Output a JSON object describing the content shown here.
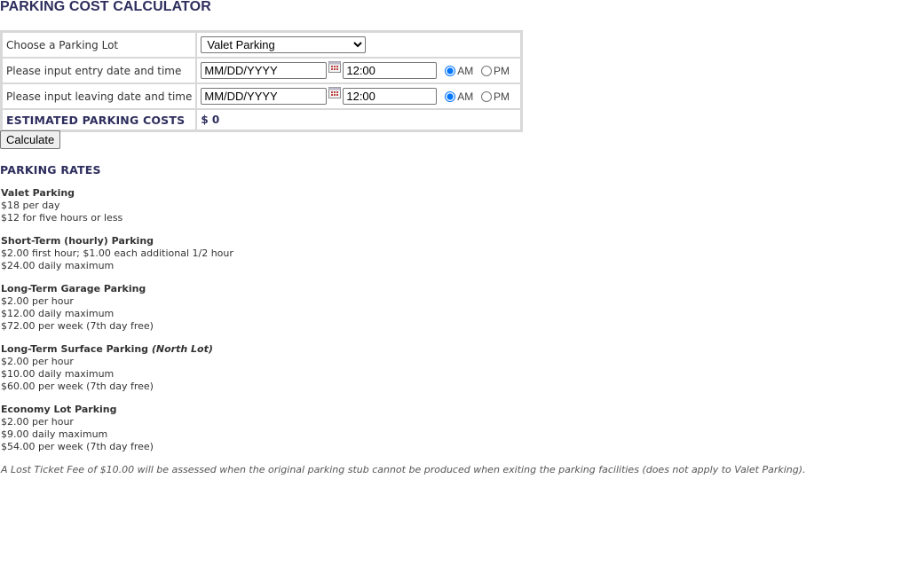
{
  "page": {
    "title": "PARKING COST CALCULATOR"
  },
  "form": {
    "lot": {
      "label": "Choose a Parking Lot",
      "selected": "Valet Parking"
    },
    "entry": {
      "label": "Please input entry date and time",
      "date_value": "MM/DD/YYYY",
      "time_value": "12:00",
      "am_label": "AM",
      "pm_label": "PM",
      "selected": "AM"
    },
    "leaving": {
      "label": "Please input leaving date and time",
      "date_value": "MM/DD/YYYY",
      "time_value": "12:00",
      "am_label": "AM",
      "pm_label": "PM",
      "selected": "AM"
    },
    "estimate": {
      "label": "ESTIMATED PARKING COSTS",
      "value": "$ 0"
    },
    "calculate_label": "Calculate"
  },
  "rates": {
    "heading": "PARKING RATES",
    "items": [
      {
        "title": "Valet Parking",
        "lines": [
          "$18 per day",
          "$12 for five hours or less"
        ]
      },
      {
        "title": "Short-Term (hourly) Parking",
        "lines": [
          "$2.00 first hour; $1.00 each additional 1/2 hour",
          "$24.00 daily maximum"
        ]
      },
      {
        "title": "Long-Term Garage Parking",
        "lines": [
          "$2.00 per hour",
          "$12.00 daily maximum",
          "$72.00 per week (7th day free)"
        ]
      },
      {
        "title": "Long-Term Surface Parking",
        "title_note": "(North Lot)",
        "lines": [
          "$2.00 per hour",
          "$10.00 daily maximum",
          "$60.00 per week (7th day free)"
        ]
      },
      {
        "title": "Economy Lot Parking",
        "lines": [
          "$2.00 per hour",
          "$9.00 daily maximum",
          "$54.00 per week (7th day free)"
        ]
      }
    ],
    "lost_ticket_note": "A Lost Ticket Fee of $10.00 will be assessed when the original parking stub cannot be produced when exiting the parking facilities (does not apply to Valet Parking)."
  },
  "colors": {
    "heading": "#2e2e5e",
    "table_border": "#d8d8d8",
    "body_text": "#333333"
  },
  "icons": {
    "calendar": "calendar-icon"
  }
}
